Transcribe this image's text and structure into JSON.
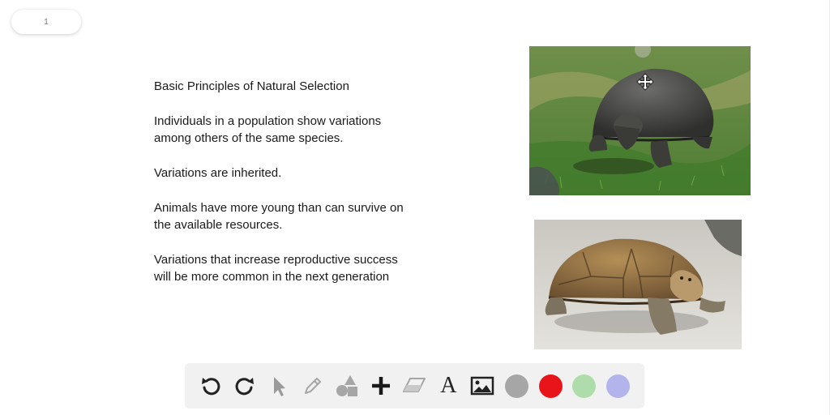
{
  "page_indicator": {
    "label": "1"
  },
  "slide": {
    "heading": "Basic Principles of Natural Selection",
    "paragraphs": [
      {
        "lines": [
          "Individuals in a population show variations",
          "among others of the same species."
        ]
      },
      {
        "lines": [
          "Variations are inherited."
        ]
      },
      {
        "lines": [
          "Animals have more young than can survive on",
          "the available resources."
        ]
      },
      {
        "lines": [
          "Variations that increase reproductive success",
          "will be more common in the next generation"
        ]
      }
    ]
  },
  "images": [
    {
      "name": "giant-tortoise-on-grass-photo"
    },
    {
      "name": "tortoise-on-sand-photo"
    }
  ],
  "toolbar": {
    "tools": [
      {
        "name": "undo-icon"
      },
      {
        "name": "redo-icon"
      },
      {
        "name": "select-pointer-icon"
      },
      {
        "name": "pen-icon"
      },
      {
        "name": "shapes-icon"
      },
      {
        "name": "add-plus-icon"
      },
      {
        "name": "eraser-icon"
      },
      {
        "name": "text-tool-icon",
        "label": "A"
      },
      {
        "name": "insert-image-icon"
      }
    ],
    "colors": [
      {
        "name": "gray",
        "hex": "#a6a6a6"
      },
      {
        "name": "red",
        "hex": "#e8141a"
      },
      {
        "name": "green",
        "hex": "#aedcab"
      },
      {
        "name": "lavender",
        "hex": "#b4b4ec"
      }
    ]
  }
}
